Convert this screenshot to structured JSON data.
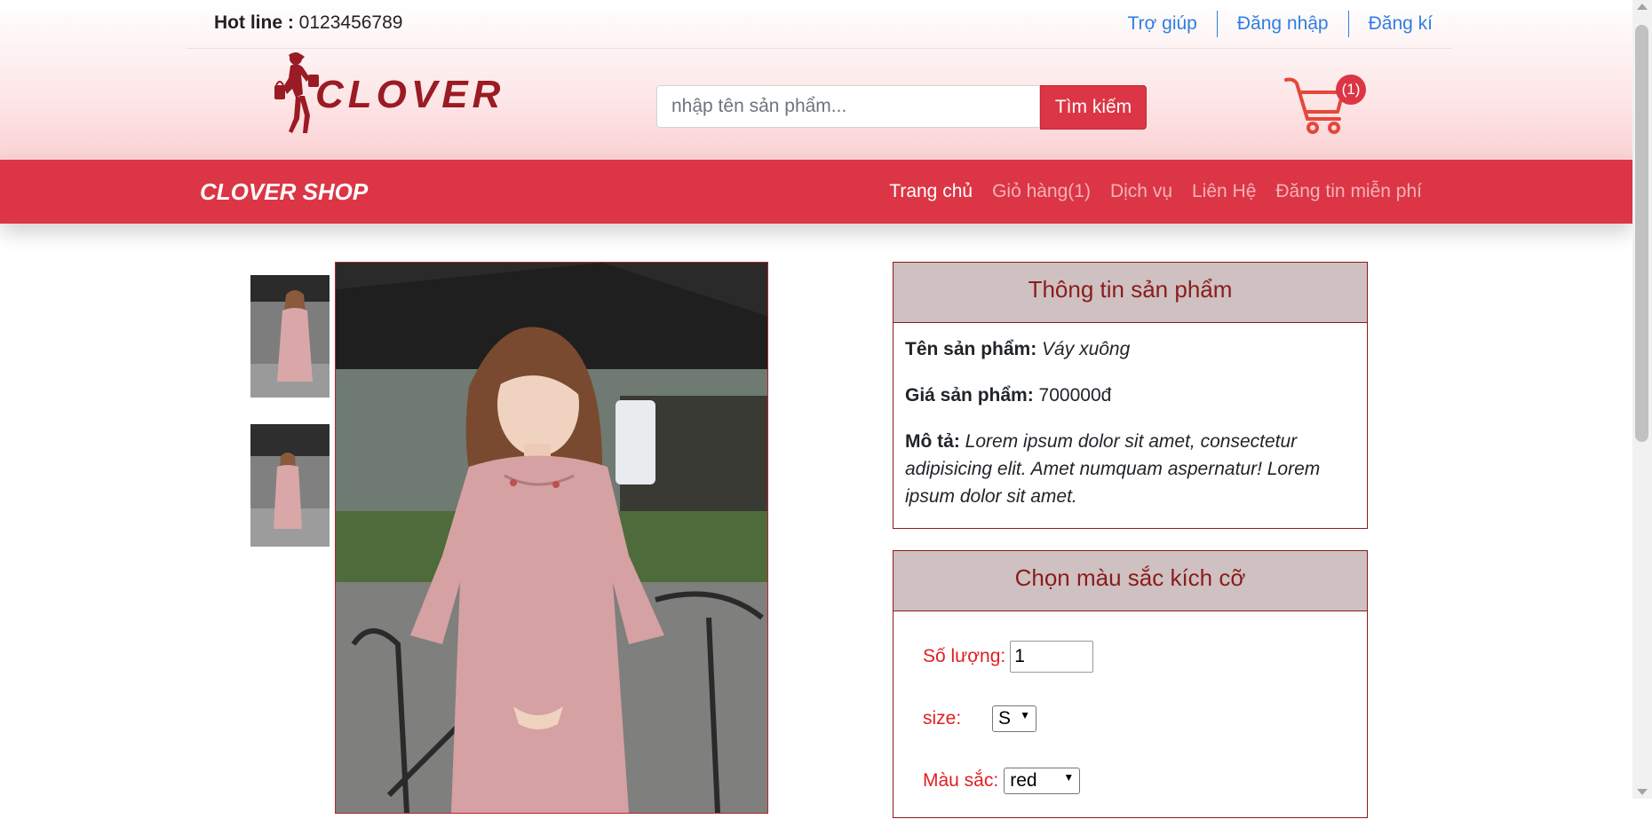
{
  "topbar": {
    "hotline_label": "Hot line :",
    "hotline_number": "0123456789",
    "links": [
      "Trợ giúp",
      "Đăng nhập",
      "Đăng kí"
    ]
  },
  "logo": {
    "text": "CLOVER"
  },
  "search": {
    "placeholder": "nhập tên sản phẩm...",
    "button_label": "Tìm kiếm"
  },
  "cart": {
    "badge": "(1)",
    "icon": "shopping-cart-icon"
  },
  "navbar": {
    "brand": "CLOVER SHOP",
    "items": [
      "Trang chủ",
      "Giỏ hàng(1)",
      "Dịch vụ",
      "Liên Hệ",
      "Đăng tin miễn phí"
    ],
    "active_index": 0
  },
  "product_info": {
    "heading": "Thông tin sản phẩm",
    "name_label": "Tên sản phẩm:",
    "name_value": "Váy xuông",
    "price_label": "Giá sản phẩm:",
    "price_value": "700000đ",
    "desc_label": "Mô tả:",
    "desc_value": "Lorem ipsum dolor sit amet, consectetur adipisicing elit. Amet numquam aspernatur! Lorem ipsum dolor sit amet."
  },
  "options": {
    "heading": "Chọn màu sắc kích cỡ",
    "qty_label": "Số lượng:",
    "qty_value": "1",
    "size_label": "size:",
    "size_value": "S",
    "color_label": "Màu sắc:",
    "color_value": "red"
  },
  "colors": {
    "accent": "#dc3545",
    "panel_head": "#cfc0c1",
    "panel_text": "#8a1c1c",
    "link": "#2f7fe0"
  }
}
